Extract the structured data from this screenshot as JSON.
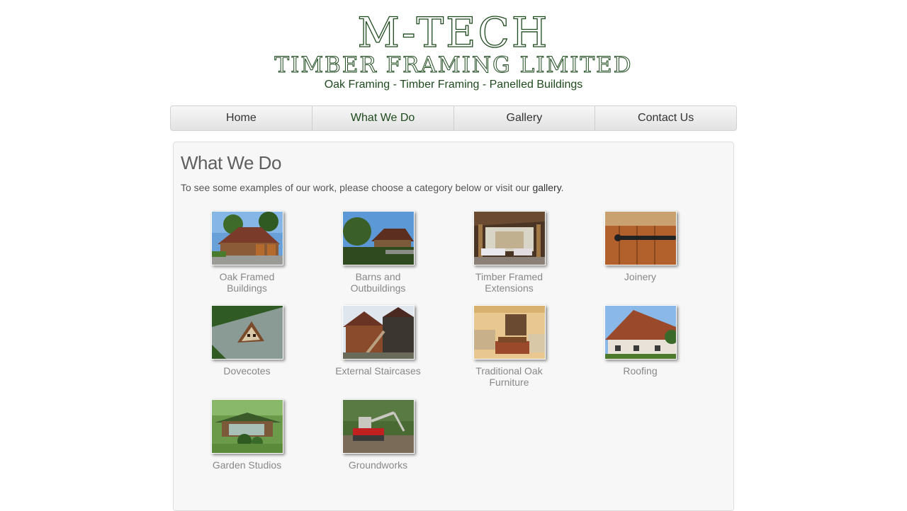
{
  "header": {
    "logo_line1": "M-TECH",
    "logo_line2": "TIMBER FRAMING LIMITED",
    "tagline": "Oak Framing - Timber Framing - Panelled Buildings"
  },
  "nav": {
    "items": [
      {
        "label": "Home"
      },
      {
        "label": "What We Do"
      },
      {
        "label": "Gallery"
      },
      {
        "label": "Contact Us"
      }
    ],
    "active": "What We Do"
  },
  "main": {
    "title": "What We Do",
    "intro_text": "To see some examples of our work, please choose a category below or visit our ",
    "intro_link": "gallery",
    "intro_end": ".",
    "categories": [
      {
        "label_line1": "Oak Framed",
        "label_line2": "Buildings"
      },
      {
        "label_line1": "Barns and",
        "label_line2": "Outbuildings"
      },
      {
        "label_line1": "Timber Framed",
        "label_line2": "Extensions"
      },
      {
        "label_line1": "Joinery",
        "label_line2": ""
      },
      {
        "label_line1": "Dovecotes",
        "label_line2": ""
      },
      {
        "label_line1": "External Staircases",
        "label_line2": ""
      },
      {
        "label_line1": "Traditional Oak",
        "label_line2": "Furniture"
      },
      {
        "label_line1": "Roofing",
        "label_line2": ""
      },
      {
        "label_line1": "Garden Studios",
        "label_line2": ""
      },
      {
        "label_line1": "Groundworks",
        "label_line2": ""
      }
    ]
  },
  "colors": {
    "brand_green": "#1d4a1d",
    "panel_background": "#f7f7f7",
    "caption_grey": "#888888"
  }
}
